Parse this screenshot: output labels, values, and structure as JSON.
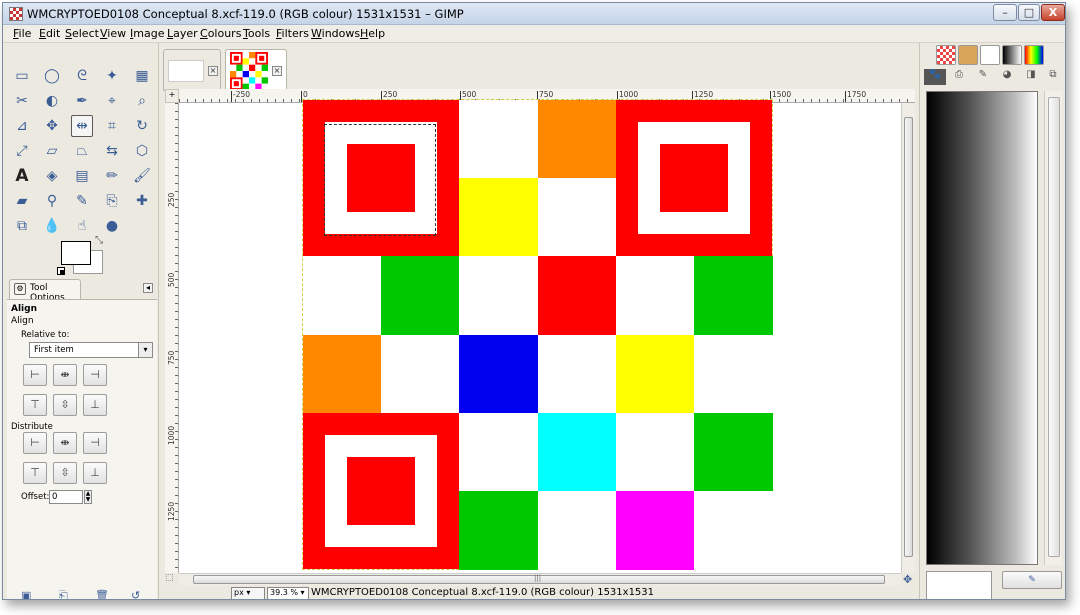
{
  "window": {
    "title": "WMCRYPTOED0108 Conceptual 8.xcf-119.0 (RGB colour) 1531x1531 – GIMP",
    "minimize": "–",
    "maximize": "□",
    "close": "X"
  },
  "menu": [
    "File",
    "Edit",
    "Select",
    "View",
    "Image",
    "Layer",
    "Colours",
    "Tools",
    "Filters",
    "Windows",
    "Help"
  ],
  "toolbox": {
    "tools": [
      {
        "name": "rect-select-tool-icon",
        "glyph": "▭"
      },
      {
        "name": "ellipse-select-tool-icon",
        "glyph": "◯"
      },
      {
        "name": "free-select-tool-icon",
        "glyph": "ᘓ"
      },
      {
        "name": "fuzzy-select-tool-icon",
        "glyph": "✦"
      },
      {
        "name": "select-by-color-tool-icon",
        "glyph": "▦"
      },
      {
        "name": "scissors-tool-icon",
        "glyph": "✂"
      },
      {
        "name": "foreground-select-tool-icon",
        "glyph": "◐"
      },
      {
        "name": "paths-tool-icon",
        "glyph": "✒"
      },
      {
        "name": "color-picker-tool-icon",
        "glyph": "⌖"
      },
      {
        "name": "zoom-tool-icon",
        "glyph": "⌕"
      },
      {
        "name": "measure-tool-icon",
        "glyph": "⊿"
      },
      {
        "name": "move-tool-icon",
        "glyph": "✥"
      },
      {
        "name": "align-tool-icon",
        "glyph": "⇹"
      },
      {
        "name": "crop-tool-icon",
        "glyph": "⌗"
      },
      {
        "name": "rotate-tool-icon",
        "glyph": "↻"
      },
      {
        "name": "scale-tool-icon",
        "glyph": "⤢"
      },
      {
        "name": "shear-tool-icon",
        "glyph": "▱"
      },
      {
        "name": "perspective-tool-icon",
        "glyph": "⏢"
      },
      {
        "name": "flip-tool-icon",
        "glyph": "⇆"
      },
      {
        "name": "cage-transform-tool-icon",
        "glyph": "⬡"
      },
      {
        "name": "text-tool-icon",
        "glyph": "A"
      },
      {
        "name": "bucket-fill-tool-icon",
        "glyph": "◈"
      },
      {
        "name": "blend-tool-icon",
        "glyph": "▤"
      },
      {
        "name": "pencil-tool-icon",
        "glyph": "✏"
      },
      {
        "name": "paintbrush-tool-icon",
        "glyph": "🖌"
      },
      {
        "name": "eraser-tool-icon",
        "glyph": "▰"
      },
      {
        "name": "airbrush-tool-icon",
        "glyph": "⚲"
      },
      {
        "name": "ink-tool-icon",
        "glyph": "✎"
      },
      {
        "name": "clone-tool-icon",
        "glyph": "⎘"
      },
      {
        "name": "heal-tool-icon",
        "glyph": "✚"
      },
      {
        "name": "perspective-clone-tool-icon",
        "glyph": "⧉"
      },
      {
        "name": "blur-tool-icon",
        "glyph": "💧"
      },
      {
        "name": "smudge-tool-icon",
        "glyph": "☝"
      },
      {
        "name": "dodge-burn-tool-icon",
        "glyph": "●"
      }
    ],
    "active_tool": "align-tool-icon"
  },
  "tool_options": {
    "tab_label": "Tool Options",
    "title": "Align",
    "subtitle": "Align",
    "relative_to_label": "Relative to:",
    "relative_to_value": "First item",
    "distribute_label": "Distribute",
    "offset_label": "Offset:",
    "offset_value": "0"
  },
  "image_window": {
    "ruler_corner": "+",
    "hruler_labels": [
      "-250",
      "0",
      "250",
      "500",
      "750",
      "1000",
      "1250",
      "1500",
      "1750"
    ],
    "vruler_labels": [
      "250",
      "500",
      "750",
      "1000",
      "1250"
    ],
    "unit": "px",
    "zoom": "39.3 %",
    "status": "WMCRYPTOED0108 Conceptual 8.xcf-119.0 (RGB colour) 1531x1531",
    "scroll_grip": "|||"
  },
  "qr_colors": {
    "red": "#ff0000",
    "white": "#ffffff",
    "orange": "#ff8800",
    "yellow": "#ffff00",
    "green": "#00c800",
    "blue": "#0000ee",
    "cyan": "#00ffff",
    "magenta": "#ff00ff"
  },
  "dock": {
    "bottom_button": "✎"
  }
}
